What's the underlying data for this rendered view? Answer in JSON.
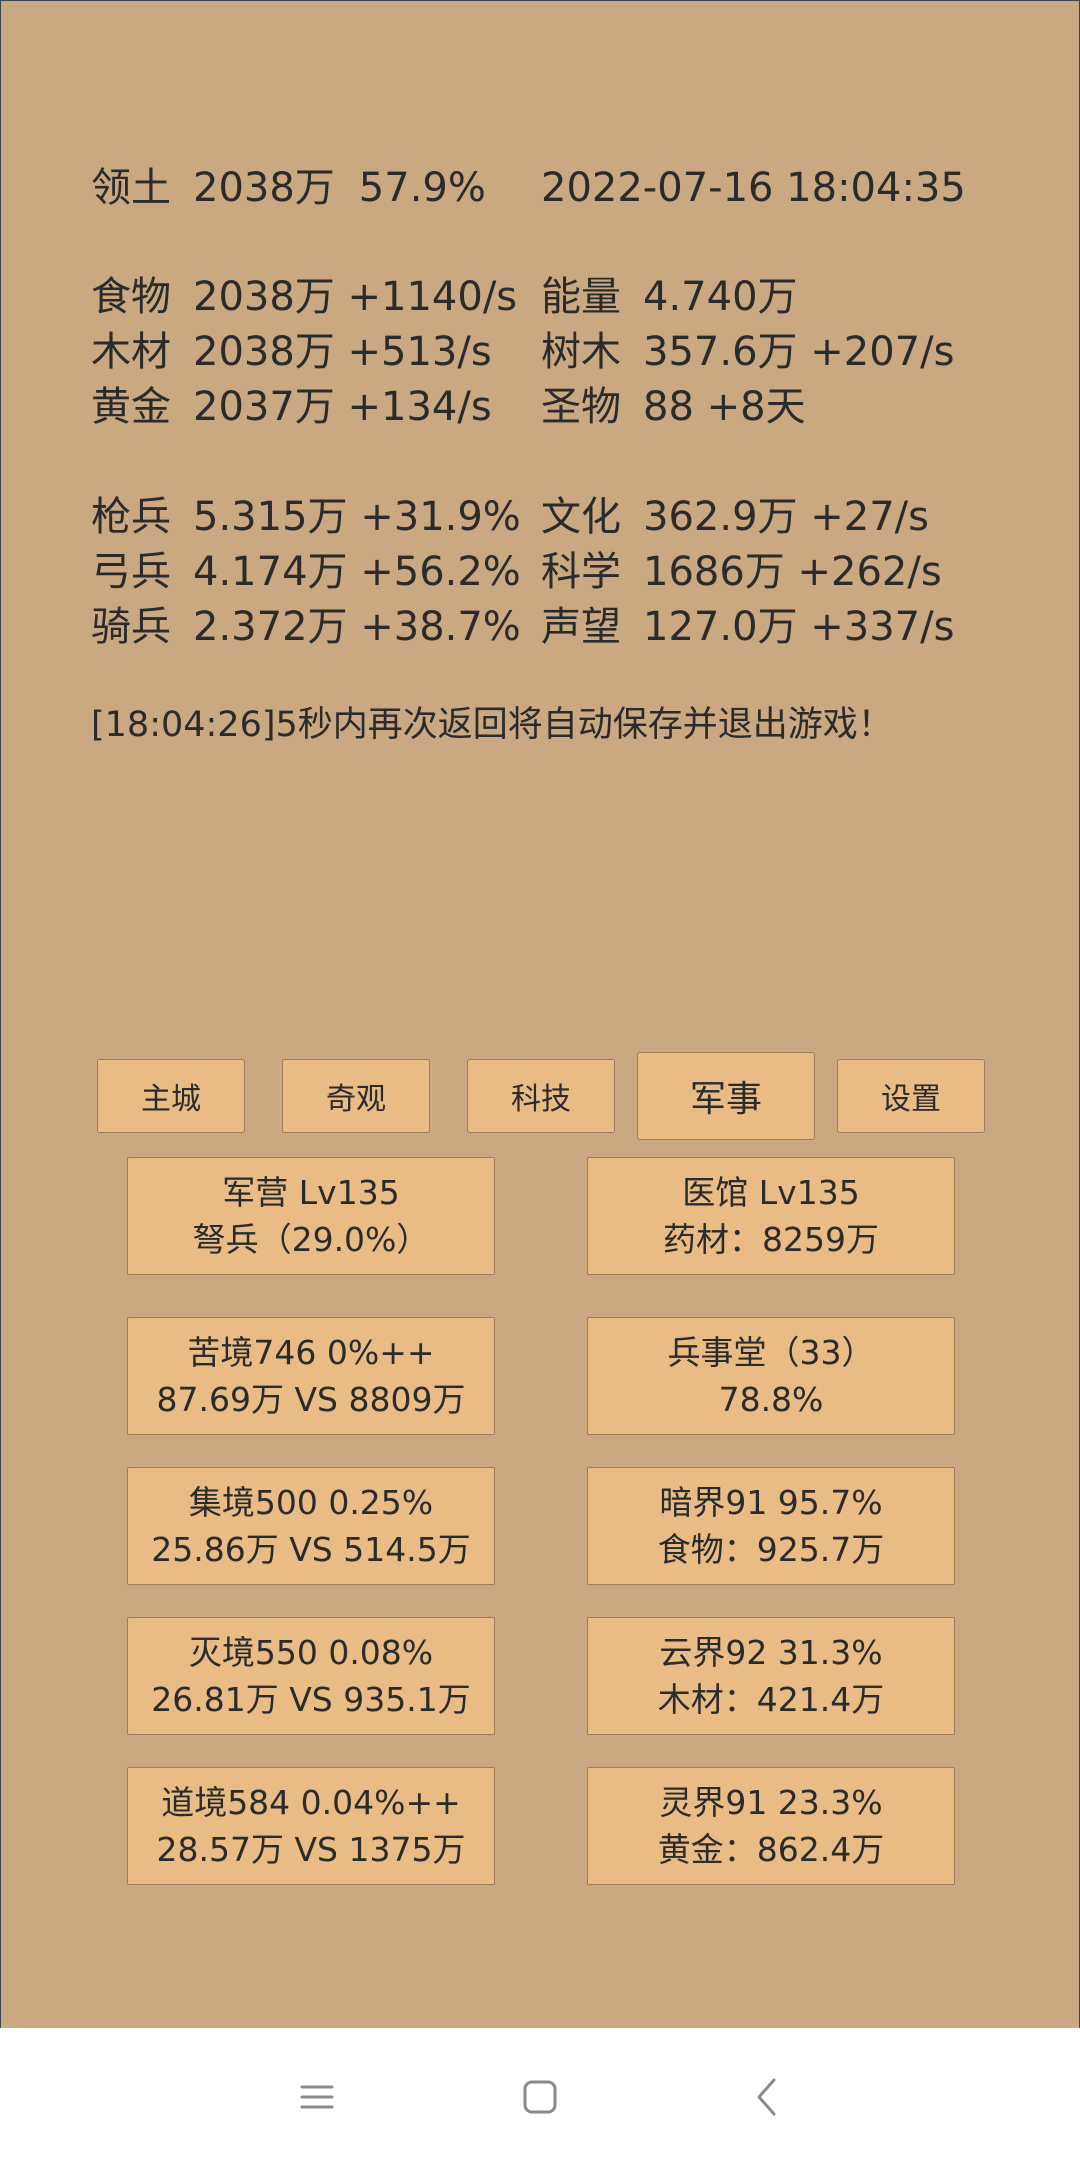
{
  "territory": {
    "label": "领土",
    "value": "2038万",
    "percent": "57.9%"
  },
  "datetime": "2022-07-16 18:04:35",
  "resources_left": [
    {
      "label": "食物",
      "value": "2038万 +1140/s"
    },
    {
      "label": "木材",
      "value": "2038万 +513/s"
    },
    {
      "label": "黄金",
      "value": "2037万 +134/s"
    }
  ],
  "resources_right": [
    {
      "label": "能量",
      "value": "4.740万"
    },
    {
      "label": "树木",
      "value": "357.6万 +207/s"
    },
    {
      "label": "圣物",
      "value": "88 +8天"
    }
  ],
  "troops": [
    {
      "label": "枪兵",
      "value": "5.315万 +31.9%"
    },
    {
      "label": "弓兵",
      "value": "4.174万 +56.2%"
    },
    {
      "label": "骑兵",
      "value": "2.372万 +38.7%"
    }
  ],
  "culture": [
    {
      "label": "文化",
      "value": "362.9万 +27/s"
    },
    {
      "label": "科学",
      "value": "1686万 +262/s"
    },
    {
      "label": "声望",
      "value": "127.0万 +337/s"
    }
  ],
  "message": "[18:04:26]5秒内再次返回将自动保存并退出游戏！",
  "tabs": [
    {
      "label": "主城"
    },
    {
      "label": "奇观"
    },
    {
      "label": "科技"
    },
    {
      "label": "军事"
    },
    {
      "label": "设置"
    }
  ],
  "active_tab": "军事",
  "cards": [
    {
      "line1": "军营 Lv135",
      "line2": "弩兵（29.0%）"
    },
    {
      "line1": "医馆 Lv135",
      "line2": "药材：8259万"
    },
    {
      "line1": "苦境746  0%++",
      "line2": "87.69万 VS 8809万"
    },
    {
      "line1": "兵事堂（33）",
      "line2": "78.8%"
    },
    {
      "line1": "集境500  0.25%",
      "line2": "25.86万 VS 514.5万"
    },
    {
      "line1": "暗界91  95.7%",
      "line2": "食物：925.7万"
    },
    {
      "line1": "灭境550  0.08%",
      "line2": "26.81万 VS 935.1万"
    },
    {
      "line1": "云界92  31.3%",
      "line2": "木材：421.4万"
    },
    {
      "line1": "道境584  0.04%++",
      "line2": "28.57万 VS 1375万"
    },
    {
      "line1": "灵界91  23.3%",
      "line2": "黄金：862.4万"
    }
  ],
  "navbar": {
    "icons": [
      "menu-icon",
      "home-icon",
      "back-icon"
    ]
  },
  "colors": {
    "panel": "#c9a882",
    "button": "#e8bc84",
    "border": "#9e7e5a",
    "text": "#2b2b2b"
  }
}
